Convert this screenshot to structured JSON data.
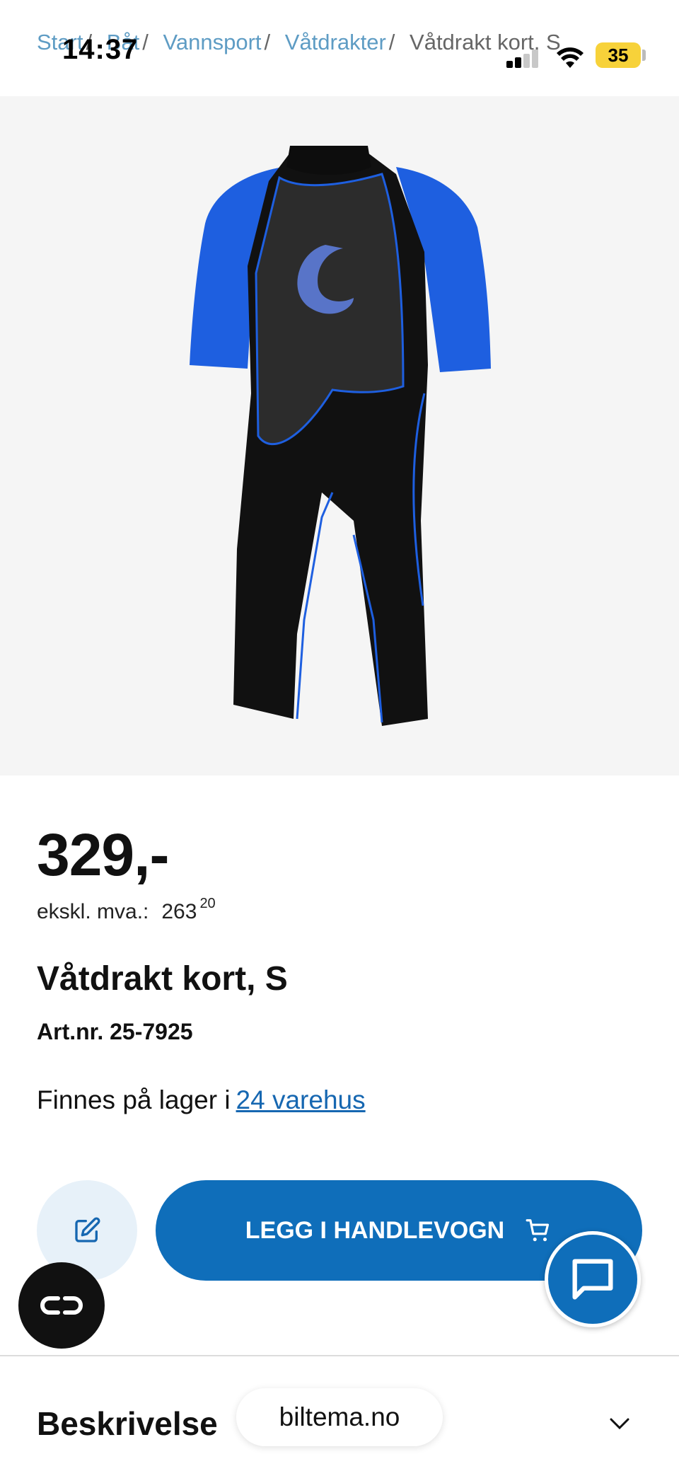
{
  "status_bar": {
    "time": "14:37",
    "battery": "35"
  },
  "breadcrumb": [
    {
      "label": "Start"
    },
    {
      "label": "Båt"
    },
    {
      "label": "Vannsport"
    },
    {
      "label": "Våtdrakter"
    },
    {
      "label": "Våtdrakt kort, S"
    }
  ],
  "product": {
    "image_icon": "wetsuit-image",
    "price": "329,-",
    "ex_vat_label": "ekskl. mva.:",
    "ex_vat_int": "263",
    "ex_vat_dec": "20",
    "name": "Våtdrakt kort, S",
    "article_number": "Art.nr. 25-7925",
    "stock_text": "Finnes på lager i",
    "stock_link": "24 varehus"
  },
  "actions": {
    "wishlist_icon": "edit-note-icon",
    "add_to_cart_label": "LEGG I HANDLEVOGN",
    "cart_icon": "cart-icon",
    "chat_icon": "chat-icon",
    "accessibility_icon": "accessibility-icon"
  },
  "description": {
    "heading": "Beskrivelse",
    "expand_icon": "chevron-down-icon"
  },
  "browser": {
    "url": "biltema.no"
  },
  "colors": {
    "accent": "#0f6eba",
    "link": "#1667b1",
    "breadcrumb": "#5e9cc4"
  }
}
